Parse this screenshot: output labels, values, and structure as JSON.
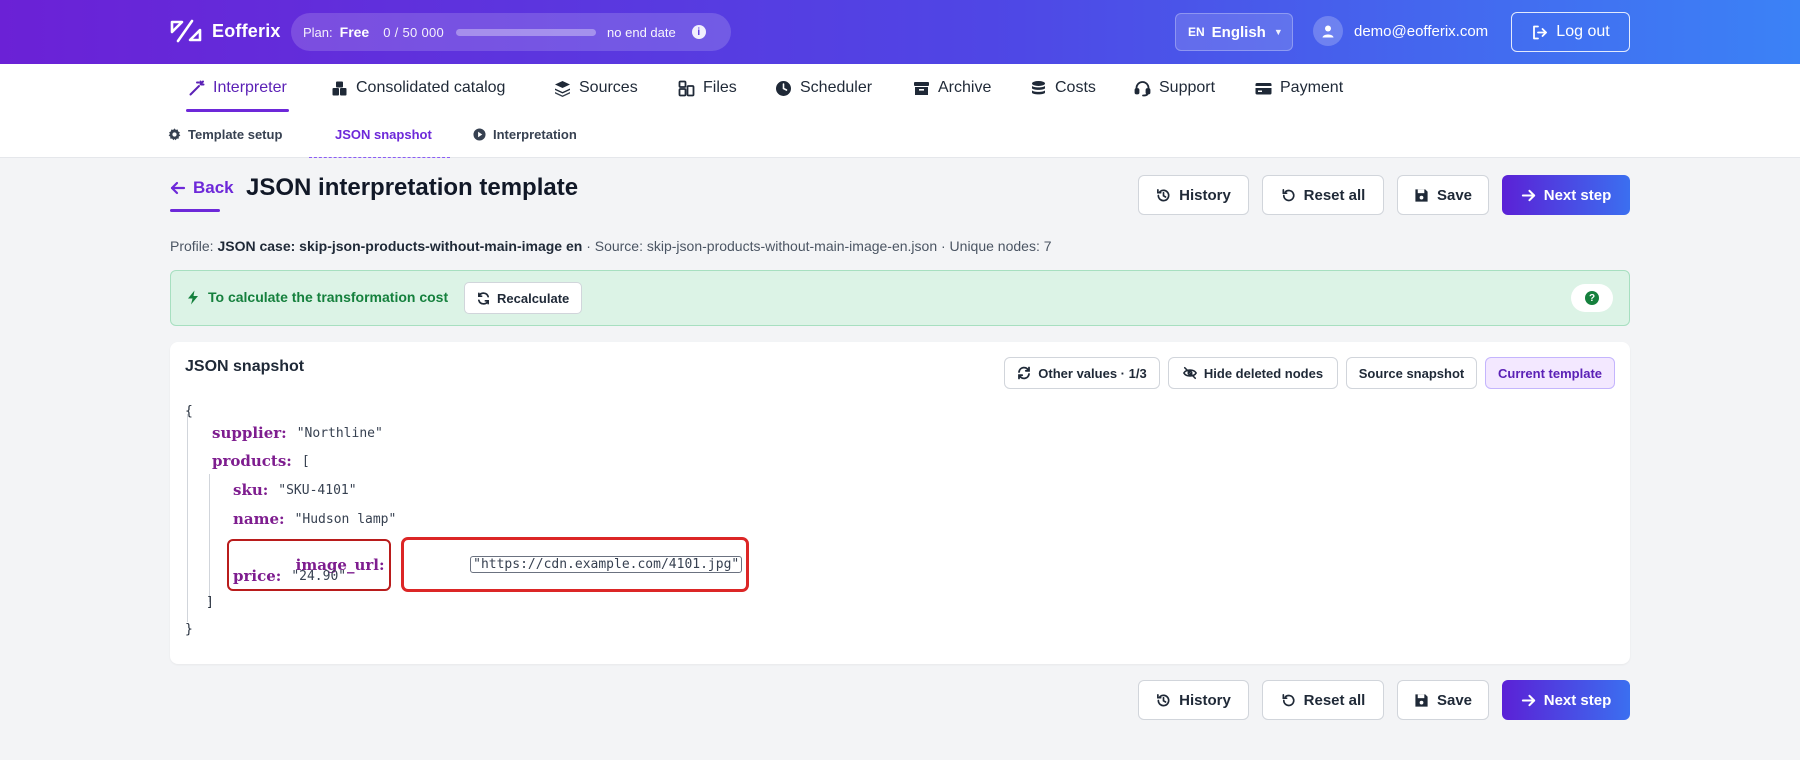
{
  "app": {
    "name": "Eofferix",
    "plan_label": "Plan:",
    "plan_tier": "Free",
    "plan_usage": "0 / 50 000",
    "plan_usage_fraction": 0,
    "plan_end": "no end date",
    "info_glyph": "i",
    "lang_code": "EN",
    "lang_name": "English",
    "user_email": "demo@eofferix.com",
    "logout_label": "Log out"
  },
  "nav": {
    "items": [
      {
        "label": "Interpreter",
        "icon": "magic-wand-icon",
        "active": true
      },
      {
        "label": "Consolidated catalog",
        "icon": "catalog-icon"
      },
      {
        "label": "Sources",
        "icon": "layers-icon"
      },
      {
        "label": "Files",
        "icon": "files-icon"
      },
      {
        "label": "Scheduler",
        "icon": "clock-icon"
      },
      {
        "label": "Archive",
        "icon": "archive-icon"
      },
      {
        "label": "Costs",
        "icon": "coins-icon"
      },
      {
        "label": "Support",
        "icon": "headset-icon"
      },
      {
        "label": "Payment",
        "icon": "credit-card-icon"
      }
    ]
  },
  "subnav": {
    "items": [
      {
        "label": "Template setup",
        "icon": "gear-icon"
      },
      {
        "label": "JSON snapshot",
        "active": true
      },
      {
        "label": "Interpretation",
        "icon": "play-circle-icon"
      }
    ]
  },
  "page": {
    "back_label": "Back",
    "title": "JSON interpretation template",
    "profile_label": "Profile:",
    "profile_name": "JSON case: skip-json-products-without-main-image en",
    "profile_rest": "· Source: skip-json-products-without-main-image-en.json · Unique nodes: 7"
  },
  "actions": {
    "history": "History",
    "reset": "Reset all",
    "save": "Save",
    "next": "Next step"
  },
  "banner": {
    "text": "To calculate the transformation cost",
    "recalc": "Recalculate",
    "help_glyph": "?"
  },
  "snapshot": {
    "title": "JSON snapshot",
    "other_values": "Other values · 1/3",
    "hide_deleted": "Hide deleted nodes",
    "source_snapshot": "Source snapshot",
    "current_template": "Current template",
    "open_brace": "{",
    "close_brace": "}",
    "open_bracket": "[",
    "close_bracket": "]",
    "supplier_key": "supplier:",
    "supplier_val": "\"Northline\"",
    "products_key": "products:",
    "sku_key": "sku:",
    "sku_val": "\"SKU-4101\"",
    "name_key": "name:",
    "name_val": "\"Hudson lamp\"",
    "image_key": "image_url:",
    "image_val": "\"https://cdn.example.com/4101.jpg\"",
    "price_key": "price:",
    "price_val": "\"24.90\""
  },
  "colors": {
    "accent": "#6d28d9",
    "header_start": "#6b21d6",
    "header_end": "#3b82f6",
    "banner_bg": "#dcf3e6",
    "banner_text": "#15803d",
    "highlight": "#dc2626"
  }
}
